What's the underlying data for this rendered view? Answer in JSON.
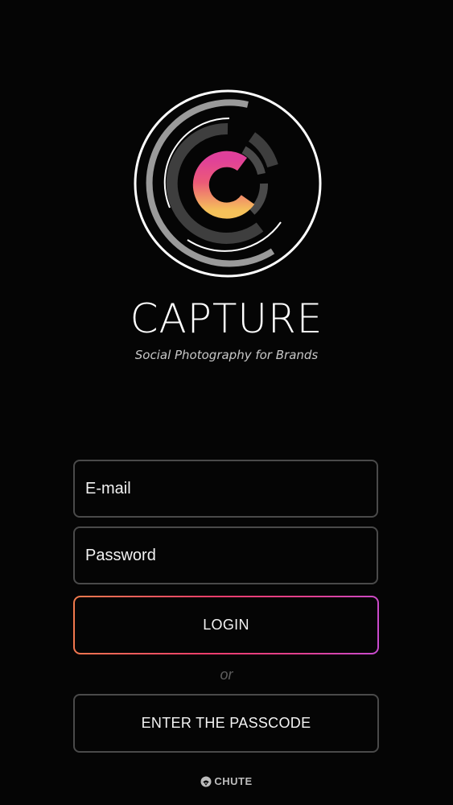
{
  "brand": {
    "name": "CAPTURE",
    "tagline": "Social Photography for Brands"
  },
  "login_form": {
    "email_placeholder": "E-mail",
    "password_placeholder": "Password",
    "login_label": "LOGIN",
    "separator": "or",
    "passcode_label": "ENTER THE PASSCODE"
  },
  "footer": {
    "company": "CHUTE"
  },
  "colors": {
    "background": "#050505",
    "field_border": "#4a4a4a",
    "accent_start": "#f07b4c",
    "accent_mid": "#ee3d6b",
    "accent_end": "#c84bd0",
    "logo_gradient_top": "#e0409a",
    "logo_gradient_bottom": "#f5c15a"
  },
  "icons": {
    "logo": "camera-aperture-logo-icon",
    "footer": "chute-logo-icon"
  }
}
